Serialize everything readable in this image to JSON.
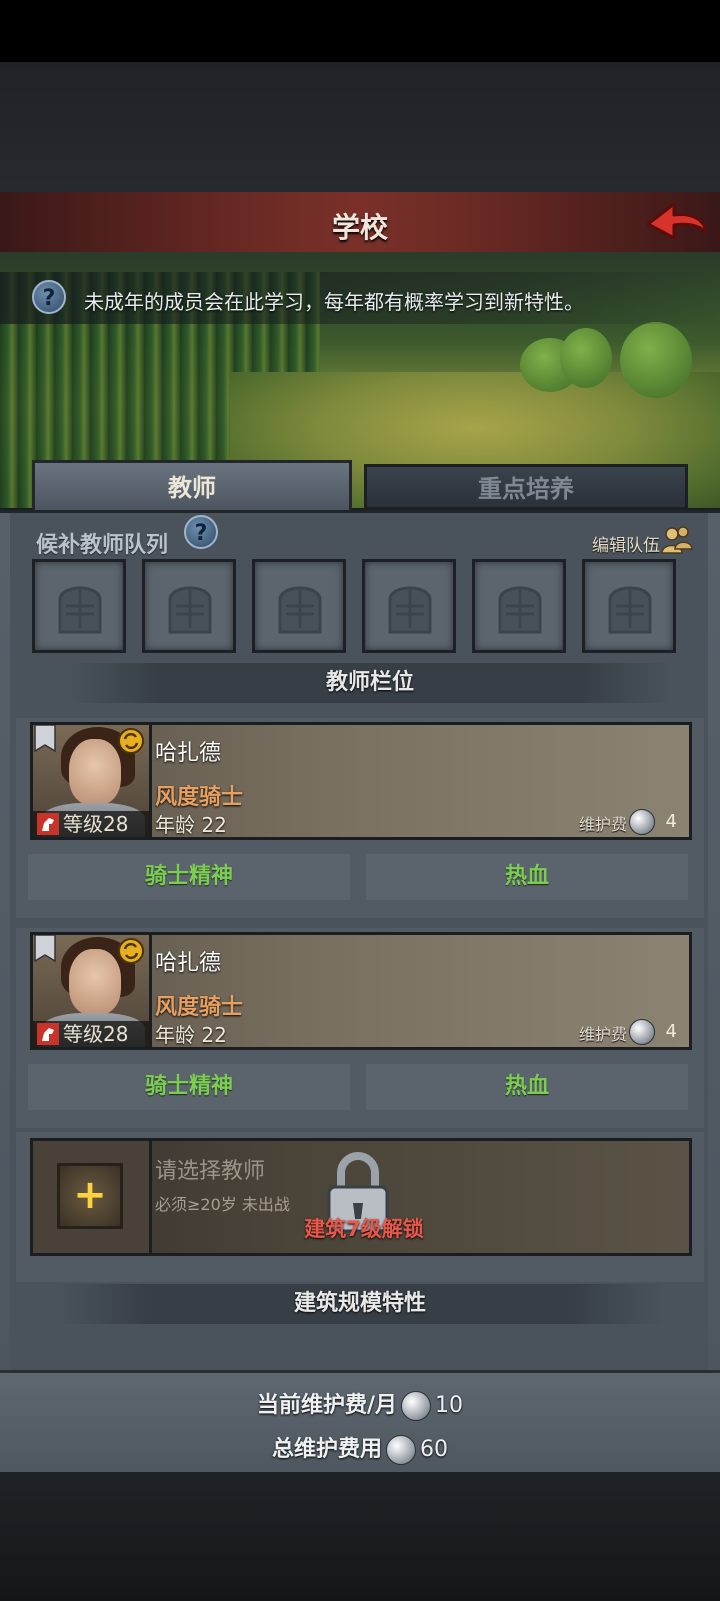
{
  "header": {
    "title": "学校",
    "back_icon": "back-arrow-icon"
  },
  "info": {
    "text": "未成年的成员会在此学习，每年都有概率学习到新特性。"
  },
  "tabs": [
    {
      "label": "教师",
      "active": true
    },
    {
      "label": "重点培养",
      "active": false
    }
  ],
  "reserve": {
    "title": "候补教师队列",
    "edit_label": "编辑队伍",
    "slot_count": 6
  },
  "teacher_section": {
    "title": "教师栏位"
  },
  "teachers": [
    {
      "name": "哈扎德",
      "class": "风度骑士",
      "age_label": "年龄",
      "age": "22",
      "level_label": "等级",
      "level": "28",
      "fee_label": "维护费",
      "fee": "4",
      "traits": [
        "骑士精神",
        "热血"
      ]
    },
    {
      "name": "哈扎德",
      "class": "风度骑士",
      "age_label": "年龄",
      "age": "22",
      "level_label": "等级",
      "level": "28",
      "fee_label": "维护费",
      "fee": "4",
      "traits": [
        "骑士精神",
        "热血"
      ]
    }
  ],
  "empty_slot": {
    "label": "请选择教师",
    "requirement": "必须≥20岁 未出战",
    "unlock": "建筑7级解锁"
  },
  "building_section": {
    "title": "建筑规模特性"
  },
  "footer": {
    "monthly_label": "当前维护费/月",
    "monthly_value": "10",
    "total_label": "总维护费用",
    "total_value": "60"
  },
  "colors": {
    "header": "#6b2a24",
    "trait_green": "#7ccc55",
    "class_orange": "#e8a060",
    "unlock_red": "#e8584a"
  }
}
